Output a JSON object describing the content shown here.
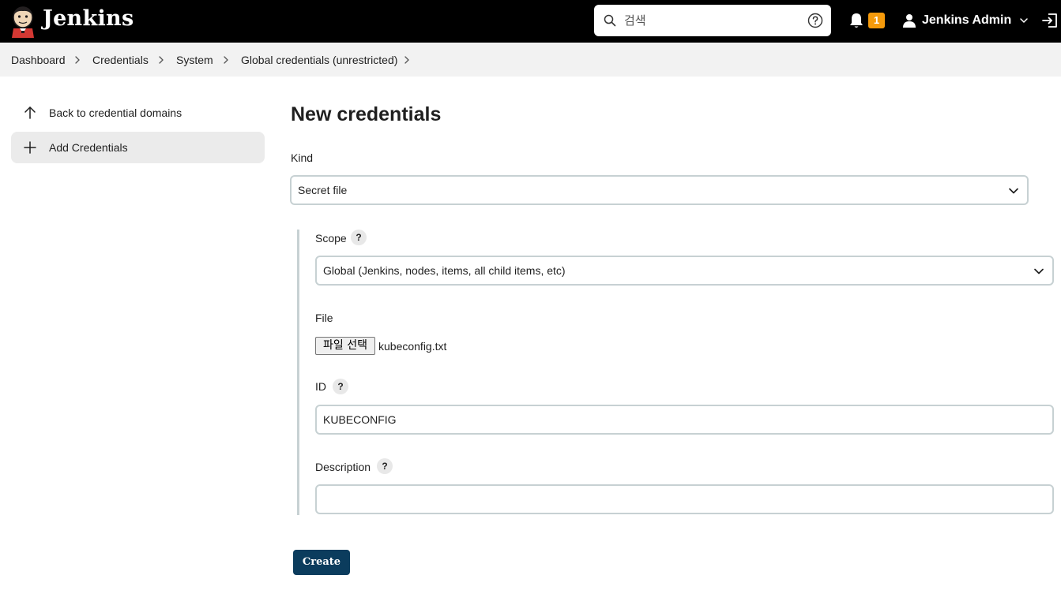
{
  "header": {
    "app_title": "Jenkins",
    "search": {
      "placeholder": "검색",
      "value": ""
    },
    "notifications": {
      "count": "1",
      "badge_color": "#f59a0b"
    },
    "user": {
      "name": "Jenkins Admin"
    }
  },
  "breadcrumb": [
    {
      "label": "Dashboard"
    },
    {
      "label": "Credentials"
    },
    {
      "label": "System"
    },
    {
      "label": "Global credentials (unrestricted)"
    }
  ],
  "sidebar": {
    "items": [
      {
        "label": "Back to credential domains",
        "icon": "arrow-up-icon",
        "active": false
      },
      {
        "label": "Add Credentials",
        "icon": "plus-icon",
        "active": true
      }
    ]
  },
  "form": {
    "title": "New credentials",
    "kind": {
      "label": "Kind",
      "value": "Secret file"
    },
    "scope": {
      "label": "Scope",
      "help": "?",
      "value": "Global (Jenkins, nodes, items, all child items, etc)"
    },
    "file": {
      "label": "File",
      "button_label": "파일 선택",
      "file_name": "kubeconfig.txt"
    },
    "id": {
      "label": "ID",
      "help": "?",
      "value": "KUBECONFIG"
    },
    "description": {
      "label": "Description",
      "help": "?",
      "value": ""
    },
    "create_label": "Create"
  },
  "colors": {
    "header_bg": "#000000",
    "breadcrumb_bg": "#f2f2f2",
    "primary_button": "#0b3c5d",
    "input_border": "#c7d1d3"
  }
}
